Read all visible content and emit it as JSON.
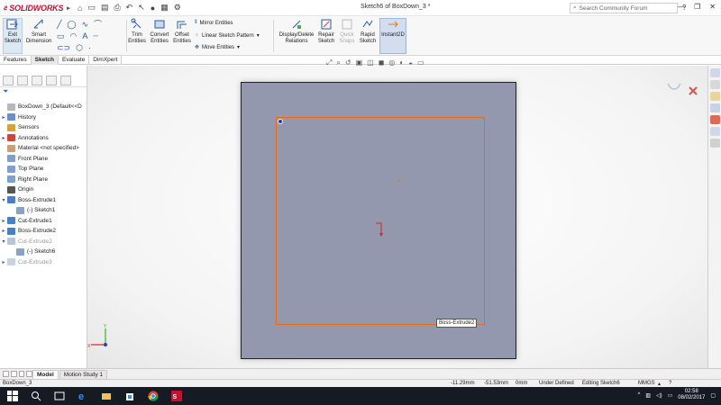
{
  "app": {
    "logo": "SOLIDWORKS",
    "doc_title": "Sketch6 of BoxDown_3 *",
    "search_placeholder": "Search Community Forum"
  },
  "ribbon": {
    "exit_sketch": "Exit Sketch",
    "smart_dimension": "Smart Dimension",
    "trim_entities": "Trim Entities",
    "convert_entities": "Convert Entities",
    "offset_entities": "Offset Entities",
    "mirror_entities": "Mirror Entities",
    "linear_sketch_pattern": "Linear Sketch Pattern",
    "move_entities": "Move Entities",
    "display_delete_relations": "Display/Delete Relations",
    "repair_sketch": "Repair Sketch",
    "quick_snaps": "Quick Snaps",
    "rapid_sketch": "Rapid Sketch",
    "instant2d": "Instant2D"
  },
  "tabs": [
    "Features",
    "Sketch",
    "Evaluate",
    "DimXpert"
  ],
  "active_tab": "Sketch",
  "tree": [
    {
      "label": "BoxDown_3  (Default<<D",
      "exp": "",
      "color": "#b8b8b8",
      "dim": false
    },
    {
      "label": "History",
      "exp": "▸",
      "color": "#6b8fc9",
      "dim": false
    },
    {
      "label": "Sensors",
      "exp": "",
      "color": "#d8a23a",
      "dim": false
    },
    {
      "label": "Annotations",
      "exp": "▸",
      "color": "#c84a3a",
      "dim": false
    },
    {
      "label": "Material <not specified>",
      "exp": "",
      "color": "#c9a07a",
      "dim": false
    },
    {
      "label": "Front Plane",
      "exp": "",
      "color": "#7fa0cf",
      "dim": false
    },
    {
      "label": "Top Plane",
      "exp": "",
      "color": "#7fa0cf",
      "dim": false
    },
    {
      "label": "Right Plane",
      "exp": "",
      "color": "#7fa0cf",
      "dim": false
    },
    {
      "label": "Origin",
      "exp": "",
      "color": "#555555",
      "dim": false
    },
    {
      "label": "Boss-Extrude1",
      "exp": "▾",
      "color": "#4a7fc4",
      "dim": false
    },
    {
      "label": "(-) Sketch1",
      "exp": "",
      "color": "#8aa2c4",
      "dim": false
    },
    {
      "label": "Cut-Extrude1",
      "exp": "▸",
      "color": "#4a7fc4",
      "dim": false
    },
    {
      "label": "Boss-Extrude2",
      "exp": "▸",
      "color": "#4a7fc4",
      "dim": false
    },
    {
      "label": "Cut-Extrude2",
      "exp": "▾",
      "color": "#b8c6da",
      "dim": true
    },
    {
      "label": "(-) Sketch6",
      "exp": "",
      "color": "#8aa2c4",
      "dim": false
    },
    {
      "label": "Cut-Extrude3",
      "exp": "▸",
      "color": "#c9d2df",
      "dim": true
    }
  ],
  "graphics": {
    "feature_label": "Boss-Extrude2",
    "plane_color": "#9498ae",
    "sketch_color": "#e56d1a"
  },
  "model_tabs": [
    "Model",
    "Motion Study 1"
  ],
  "status": {
    "doc": "BoxDown_3",
    "x": "-11.29mm",
    "y": "-51.53mm",
    "z": "0mm",
    "state": "Under Defined",
    "editing": "Editing Sketch6",
    "units": "MMGS"
  },
  "taskbar": {
    "time": "02:58",
    "date": "08/02/2017"
  }
}
